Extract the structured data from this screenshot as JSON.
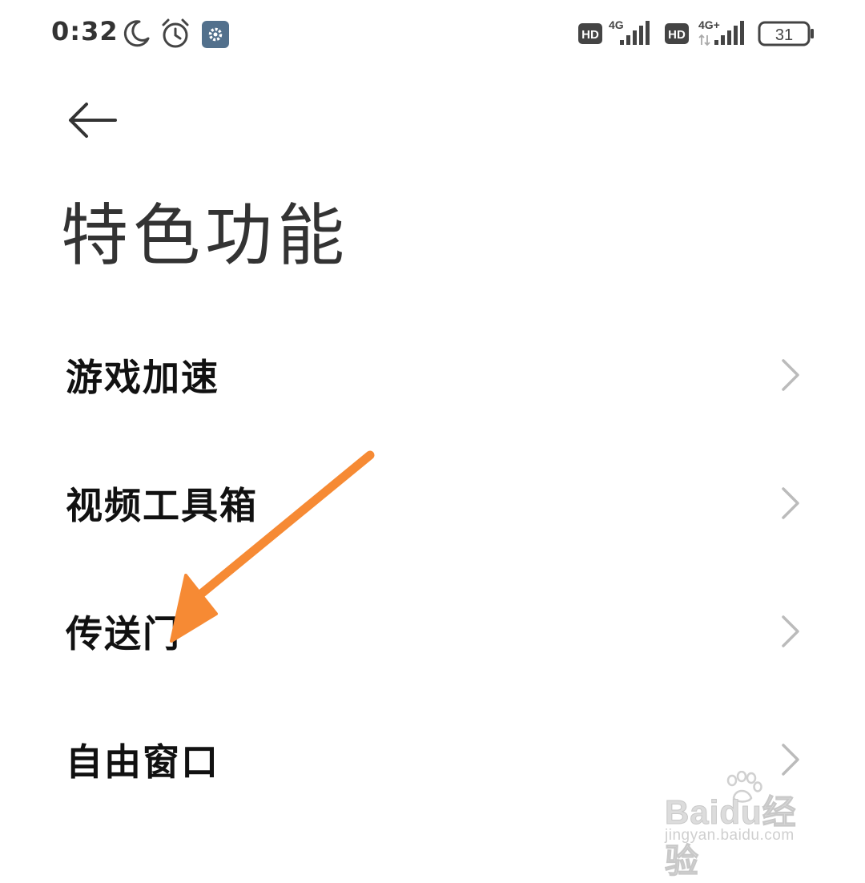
{
  "status_bar": {
    "time": "0:32",
    "icons": [
      "moon-icon",
      "alarm-icon",
      "settings-notification-icon",
      "hd-icon",
      "signal-4g-icon",
      "hd-icon",
      "signal-4g-plus-icon",
      "battery-icon"
    ],
    "network_1": "4G",
    "network_2": "4G+",
    "hd_label": "HD",
    "battery_level": "31"
  },
  "header": {
    "back_icon": "arrow-left-icon",
    "title": "特色功能"
  },
  "list": {
    "items": [
      {
        "label": "游戏加速",
        "icon": "chevron-right-icon"
      },
      {
        "label": "视频工具箱",
        "icon": "chevron-right-icon"
      },
      {
        "label": "传送门",
        "icon": "chevron-right-icon"
      },
      {
        "label": "自由窗口",
        "icon": "chevron-right-icon"
      }
    ]
  },
  "annotation": {
    "arrow_color": "#f68a34",
    "points_to": "传送门"
  },
  "watermark": {
    "brand": "Baidu经验",
    "url": "jingyan.baidu.com"
  },
  "colors": {
    "background": "#ffffff",
    "text_primary": "#111111",
    "text_title": "#333333",
    "chevron": "#bbbbbb",
    "status_icons": "#444444",
    "settings_badge": "#52708c"
  }
}
